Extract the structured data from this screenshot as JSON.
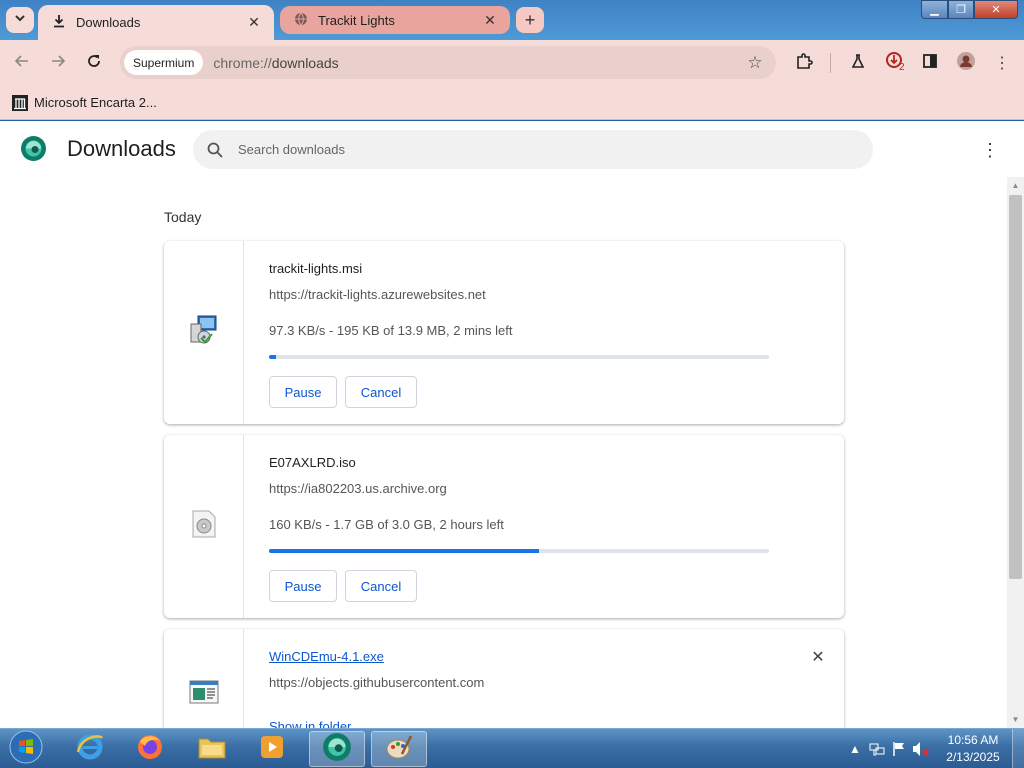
{
  "browser": {
    "tabs": [
      {
        "title": "Downloads",
        "icon": "download-icon",
        "active": true
      },
      {
        "title": "Trackit Lights",
        "icon": "globe-icon",
        "active": false
      }
    ],
    "omnibox": {
      "site_chip": "Supermium",
      "url_scheme": "chrome://",
      "url_path": "downloads"
    },
    "downloads_badge": "2",
    "bookmarks": [
      {
        "label": "Microsoft Encarta 2...",
        "icon": "encarta-icon"
      }
    ]
  },
  "page": {
    "title": "Downloads",
    "search": {
      "placeholder": "Search downloads"
    },
    "section_label": "Today",
    "downloads": [
      {
        "filename": "trackit-lights.msi",
        "url": "https://trackit-lights.azurewebsites.net",
        "status": "97.3 KB/s - 195 KB of 13.9 MB, 2 mins left",
        "progress_percent": 1.4,
        "pause_label": "Pause",
        "cancel_label": "Cancel",
        "icon": "msi-installer-icon"
      },
      {
        "filename": "E07AXLRD.iso",
        "url": "https://ia802203.us.archive.org",
        "status": "160 KB/s - 1.7 GB of 3.0 GB, 2 hours left",
        "progress_percent": 54,
        "pause_label": "Pause",
        "cancel_label": "Cancel",
        "icon": "disc-image-icon"
      },
      {
        "filename": "WinCDEmu-4.1.exe",
        "url": "https://objects.githubusercontent.com",
        "action_label": "Show in folder",
        "icon": "exe-window-icon"
      }
    ]
  },
  "taskbar": {
    "apps": [
      "internet-explorer-icon",
      "firefox-icon",
      "file-explorer-icon",
      "media-player-icon",
      "supermium-icon",
      "paint-icon"
    ],
    "clock_time": "10:56 AM",
    "clock_date": "2/13/2025"
  },
  "colors": {
    "tab_active_bg": "#f6dcd8",
    "tab_inactive_bg": "#e9a59d",
    "accent": "#1a73e8",
    "link": "#0b57d0"
  }
}
